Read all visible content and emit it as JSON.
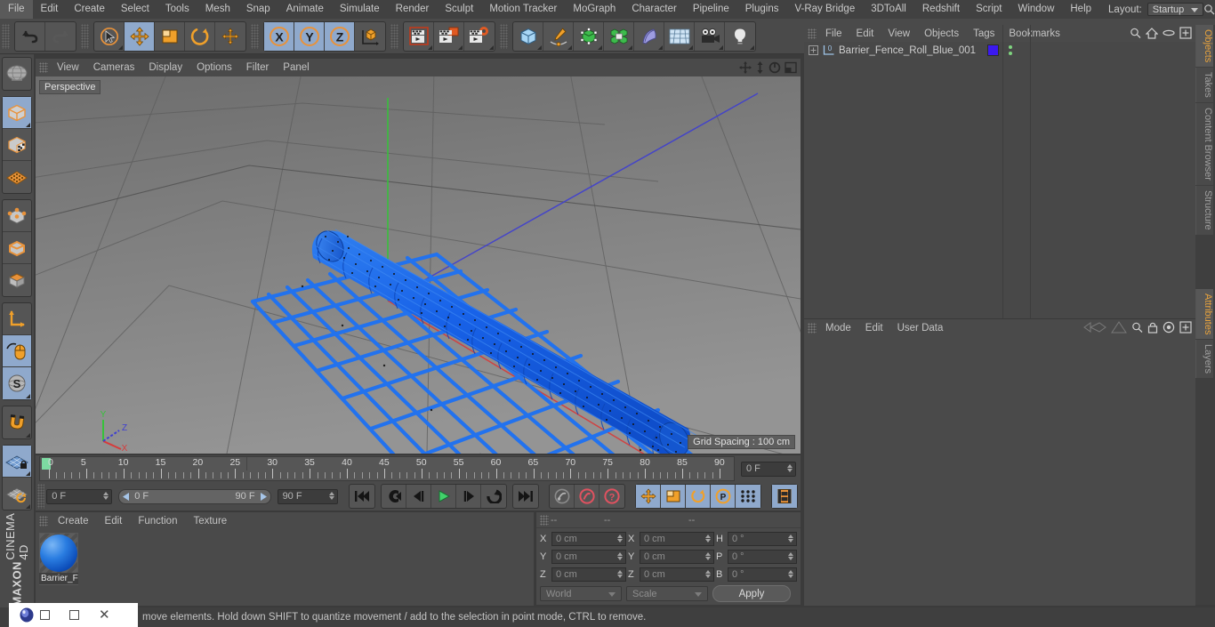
{
  "app": {
    "brand_line1": "MAXON",
    "brand_line2": "CINEMA 4D"
  },
  "menubar": {
    "items": [
      "File",
      "Edit",
      "Create",
      "Select",
      "Tools",
      "Mesh",
      "Snap",
      "Animate",
      "Simulate",
      "Render",
      "Sculpt",
      "Motion Tracker",
      "MoGraph",
      "Character",
      "Pipeline",
      "Plugins",
      "V-Ray Bridge",
      "3DToAll",
      "Redshift",
      "Script",
      "Window",
      "Help"
    ],
    "layout_label": "Layout:",
    "layout_value": "Startup",
    "search_icon": "search-icon"
  },
  "toolbar": {
    "groups": [
      {
        "name": "undo-redo",
        "buttons": [
          {
            "name": "undo",
            "icon": "undo-arrow-icon",
            "active": false,
            "disabled": false
          },
          {
            "name": "redo",
            "icon": "redo-arrow-icon",
            "active": false,
            "disabled": true
          }
        ]
      },
      {
        "name": "selection-transform",
        "buttons": [
          {
            "name": "live-selection",
            "icon": "cursor-circle-icon",
            "active": false
          },
          {
            "name": "move",
            "icon": "move-arrows-icon",
            "active": true
          },
          {
            "name": "scale",
            "icon": "scale-box-icon",
            "active": false
          },
          {
            "name": "rotate",
            "icon": "rotate-arc-icon",
            "active": false
          },
          {
            "name": "modelling-axis",
            "icon": "axis-cross-icon",
            "active": false
          }
        ]
      },
      {
        "name": "axis-locks",
        "buttons": [
          {
            "name": "lock-x",
            "icon": "x-axis-icon",
            "active": true
          },
          {
            "name": "lock-y",
            "icon": "y-axis-icon",
            "active": true
          },
          {
            "name": "lock-z",
            "icon": "z-axis-icon",
            "active": true
          },
          {
            "name": "world-object-coord",
            "icon": "world-axis-icon",
            "active": false
          }
        ]
      },
      {
        "name": "render-group",
        "buttons": [
          {
            "name": "render-view",
            "icon": "render-view-icon",
            "active": false
          },
          {
            "name": "render-to-picture-viewer",
            "icon": "render-picture-icon",
            "active": false
          },
          {
            "name": "render-settings",
            "icon": "render-settings-icon",
            "active": false
          }
        ]
      },
      {
        "name": "create-group",
        "buttons": [
          {
            "name": "add-cube-object",
            "icon": "cube-icon",
            "active": false
          },
          {
            "name": "add-spline",
            "icon": "pen-spline-icon",
            "active": false
          },
          {
            "name": "add-nurbs",
            "icon": "green-cube-nurbs-icon",
            "active": false
          },
          {
            "name": "add-array",
            "icon": "array-cluster-icon",
            "active": false
          },
          {
            "name": "add-bend-deformer",
            "icon": "bend-deformer-icon",
            "active": false
          },
          {
            "name": "add-floor-scene",
            "icon": "floor-grid-icon",
            "active": false
          },
          {
            "name": "add-camera",
            "icon": "camera-icon",
            "active": false
          },
          {
            "name": "add-light",
            "icon": "light-bulb-icon",
            "active": false
          }
        ]
      }
    ]
  },
  "leftbar": {
    "groups": [
      {
        "buttons": [
          {
            "name": "make-editable",
            "icon": "globe-wire-icon",
            "active": false
          }
        ]
      },
      {
        "buttons": [
          {
            "name": "model-mode",
            "icon": "model-cube-icon",
            "active": true
          },
          {
            "name": "texture-mode",
            "icon": "texture-checker-cube-icon",
            "active": false
          },
          {
            "name": "uv-mesh-mode",
            "icon": "uv-mesh-icon",
            "active": false
          }
        ]
      },
      {
        "buttons": [
          {
            "name": "points-mode",
            "icon": "points-cube-icon",
            "active": false
          },
          {
            "name": "edges-mode",
            "icon": "edges-cube-icon",
            "active": false
          },
          {
            "name": "polygons-mode",
            "icon": "polygons-cube-icon",
            "active": false
          }
        ]
      },
      {
        "buttons": [
          {
            "name": "object-axis-mode",
            "icon": "axis-l-icon",
            "active": false
          },
          {
            "name": "enable-axis-modification",
            "icon": "mouse-axis-icon",
            "active": true
          },
          {
            "name": "soft-selection",
            "icon": "s-sphere-icon",
            "active": true
          }
        ]
      },
      {
        "buttons": [
          {
            "name": "enable-snapping",
            "icon": "magnet-icon",
            "active": false
          }
        ]
      },
      {
        "buttons": [
          {
            "name": "lock-workplane",
            "icon": "workplane-lock-icon",
            "active": true
          },
          {
            "name": "planar-workplane",
            "icon": "workplane-rotate-icon",
            "active": false
          }
        ]
      }
    ]
  },
  "viewport": {
    "menu": [
      "View",
      "Cameras",
      "Display",
      "Filter",
      "Panel"
    ],
    "menu_full": [
      "View",
      "Cameras",
      "Display",
      "Options",
      "Filter",
      "Panel"
    ],
    "label": "Perspective",
    "grid_spacing": "Grid Spacing : 100 cm",
    "corner_icons": [
      "pan-icon",
      "dolly-icon",
      "rotate-view-icon",
      "maximize-view-icon"
    ],
    "axis_gizmo": {
      "x": "X",
      "y": "Y",
      "z": "Z"
    },
    "object_color": "#1a5fe0"
  },
  "timeline": {
    "ticks": [
      "0",
      "5",
      "10",
      "15",
      "20",
      "25",
      "30",
      "35",
      "40",
      "45",
      "50",
      "55",
      "60",
      "65",
      "70",
      "75",
      "80",
      "85",
      "90"
    ],
    "current_frame": "0 F",
    "start_frame": "0 F",
    "range_start": "0 F",
    "range_end": "90 F",
    "end_frame": "90 F"
  },
  "animbar": {
    "buttons": [
      {
        "name": "go-to-start",
        "icon": "skip-start-icon",
        "active": false
      },
      {
        "name": "go-to-previous-key",
        "icon": "prev-key-icon",
        "active": false
      },
      {
        "name": "go-to-previous-frame",
        "icon": "step-back-icon",
        "active": false
      },
      {
        "name": "play-forwards",
        "icon": "play-icon",
        "active": false
      },
      {
        "name": "go-to-next-frame",
        "icon": "step-forward-icon",
        "active": false
      },
      {
        "name": "go-to-next-key",
        "icon": "next-key-icon",
        "active": false
      },
      {
        "name": "go-to-end",
        "icon": "skip-end-icon",
        "active": false
      },
      {
        "name": "record-active-objects",
        "icon": "record-key-icon",
        "active": false
      },
      {
        "name": "autokeying",
        "icon": "autokey-icon",
        "active": false
      },
      {
        "name": "keyframe-selection",
        "icon": "keyframe-question-icon",
        "active": false
      },
      {
        "name": "position-key",
        "icon": "position-key-icon",
        "active": true
      },
      {
        "name": "scale-key",
        "icon": "scale-key-icon",
        "active": true
      },
      {
        "name": "rotation-key",
        "icon": "rotation-key-icon",
        "active": true
      },
      {
        "name": "parameter-key",
        "icon": "param-p-key-icon",
        "active": true
      },
      {
        "name": "point-level-animation",
        "icon": "pla-dots-icon",
        "active": true
      },
      {
        "name": "timeline-toggle",
        "icon": "filmstrip-icon",
        "active": true
      }
    ]
  },
  "material_manager": {
    "menu": [
      "Create",
      "Edit",
      "Function",
      "Texture"
    ],
    "materials": [
      {
        "name": "Barrier_F",
        "color": "#1a6fe0"
      }
    ]
  },
  "coordinates": {
    "header": [
      "--",
      "--",
      "--"
    ],
    "rows": [
      {
        "pos_label": "X",
        "pos_value": "0 cm",
        "size_label": "X",
        "size_value": "0 cm",
        "rot_label": "H",
        "rot_value": "0 °"
      },
      {
        "pos_label": "Y",
        "pos_value": "0 cm",
        "size_label": "Y",
        "size_value": "0 cm",
        "rot_label": "P",
        "rot_value": "0 °"
      },
      {
        "pos_label": "Z",
        "pos_value": "0 cm",
        "size_label": "Z",
        "size_value": "0 cm",
        "rot_label": "B",
        "rot_value": "0 °"
      }
    ],
    "coord_system": "World",
    "size_mode": "Scale",
    "apply_label": "Apply"
  },
  "object_manager": {
    "menu": [
      "File",
      "Edit",
      "View",
      "Objects",
      "Tags",
      "Bookmarks"
    ],
    "header_icons": [
      "search-icon",
      "home-icon",
      "ellipse-icon",
      "plus-box-icon"
    ],
    "objects": [
      {
        "name": "Barrier_Fence_Roll_Blue_001",
        "expand_icon": "expand-plus-icon",
        "type_icon": "polygon-object-icon",
        "layer_number": "0",
        "tag_color": "#3b19ef",
        "visibility_dots": 2
      }
    ]
  },
  "attribute_manager": {
    "menu": [
      "Mode",
      "Edit",
      "User Data"
    ],
    "header_icons": [
      "back-nav-icon",
      "up-nav-icon",
      "search-icon",
      "lock-icon",
      "target-icon",
      "plus-box-icon"
    ]
  },
  "right_tabs": {
    "top": [
      {
        "label": "Objects",
        "selected": true
      },
      {
        "label": "Takes",
        "selected": false
      },
      {
        "label": "Content Browser",
        "selected": false
      },
      {
        "label": "Structure",
        "selected": false
      }
    ],
    "bottom": [
      {
        "label": "Attributes",
        "selected": true
      },
      {
        "label": "Layers",
        "selected": false
      }
    ]
  },
  "statusbar": {
    "message": "move elements. Hold down SHIFT to quantize movement / add to the selection in point mode, CTRL to remove."
  },
  "taskbar": {
    "app_icon": "cinema4d-app-icon",
    "restore_icon": "restore-window-icon",
    "maximize_icon": "maximize-window-icon",
    "close_icon": "close-window-icon"
  }
}
